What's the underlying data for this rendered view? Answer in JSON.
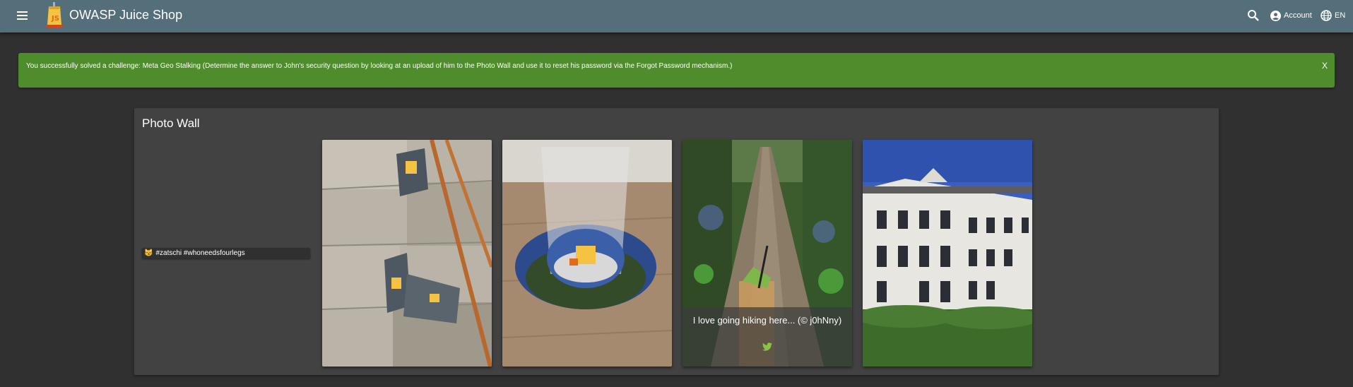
{
  "header": {
    "app_title": "OWASP Juice Shop",
    "account_label": "Account",
    "language_label": "EN",
    "icons": [
      "menu-icon",
      "juice-shop-logo",
      "search-icon",
      "account-circle-icon",
      "language-icon"
    ]
  },
  "notification": {
    "text": "You successfully solved a challenge: Meta Geo Stalking (Determine the answer to John's security question by looking at an upload of him to the Photo Wall and use it to reset his password via the Forgot Password mechanism.)",
    "close_label": "X",
    "color": "#4f8c2b"
  },
  "photo_wall": {
    "title": "Photo Wall",
    "memories": [
      {
        "caption": "#zatschi #whoneedsfourlegs",
        "emoji": "😼",
        "image": "wall-with-juice-shop-stickers-photo"
      },
      {
        "caption": "",
        "image": "glass-on-juice-shop-coaster-photo"
      },
      {
        "caption": "",
        "image": "stickers-on-pipe-wall-photo"
      },
      {
        "caption": "I love going hiking here... (© j0hNny)",
        "image": "forest-path-with-cocktail-photo",
        "twitter_icon": "twitter-icon"
      },
      {
        "caption": "",
        "image": "white-building-photo"
      }
    ]
  },
  "colors": {
    "toolbar": "#546e7a",
    "background": "#303030",
    "card": "#424242",
    "success": "#4f8c2b"
  }
}
